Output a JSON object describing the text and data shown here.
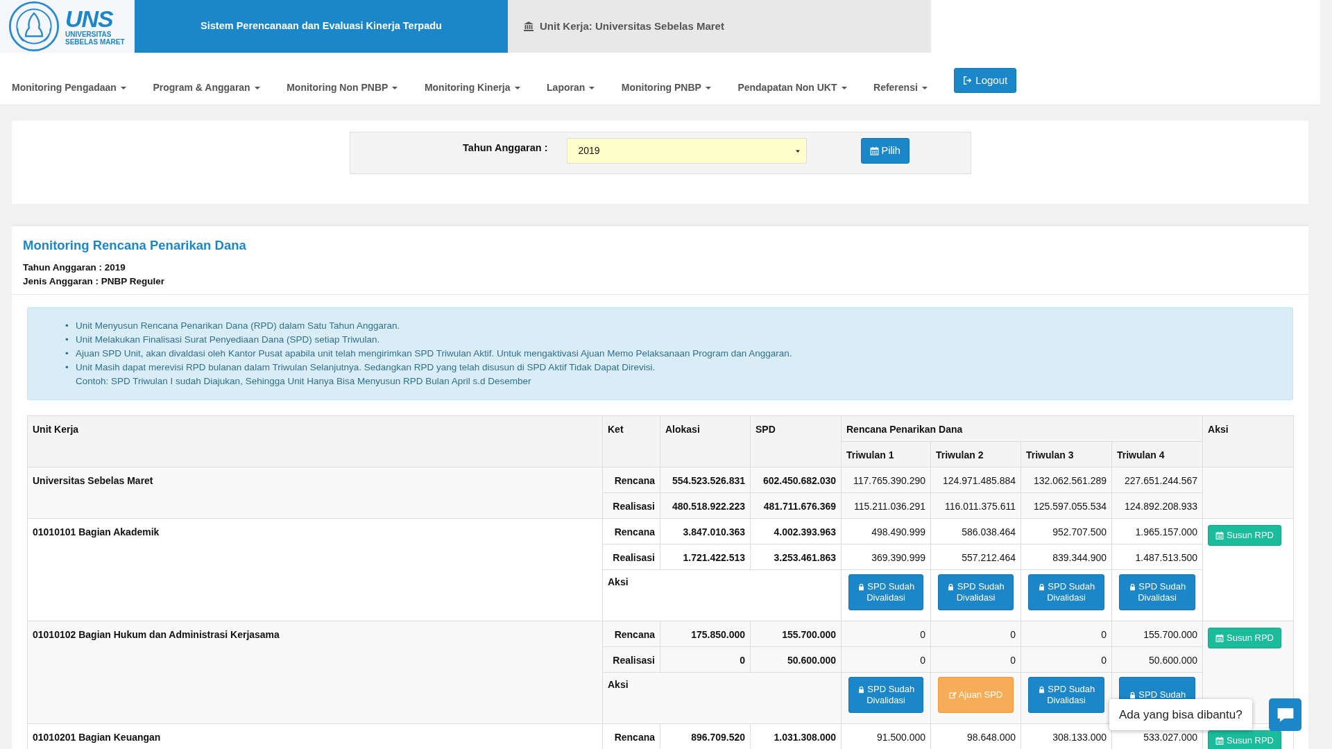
{
  "header": {
    "logo": {
      "abbr": "UNS",
      "line_1": "UNIVERSITAS",
      "line_2": "SEBELAS MARET"
    },
    "app_title": "Sistem Perencanaan dan Evaluasi Kinerja Terpadu",
    "unit_label": "Unit Kerja: Universitas Sebelas Maret"
  },
  "nav": {
    "items": [
      "Monitoring Pengadaan",
      "Program & Anggaran",
      "Monitoring Non PNBP",
      "Monitoring Kinerja",
      "Laporan",
      "Monitoring PNBP",
      "Pendapatan Non UKT",
      "Referensi"
    ],
    "logout": "Logout"
  },
  "filter": {
    "label": "Tahun Anggaran :",
    "value": "2019",
    "button": "Pilih"
  },
  "report": {
    "title": "Monitoring Rencana Penarikan Dana",
    "meta": [
      "Tahun Anggaran : 2019",
      "Jenis Anggaran : PNBP Reguler"
    ],
    "notes": [
      {
        "marker": "•",
        "text": "Unit Menyusun Rencana Penarikan Dana (RPD) dalam Satu Tahun Anggaran."
      },
      {
        "marker": "•",
        "text": "Unit Melakukan Finalisasi Surat Penyediaan Dana (SPD) setiap Triwulan."
      },
      {
        "marker": "•",
        "text": "Ajuan SPD Unit, akan divaldasi oleh Kantor Pusat apabila unit telah mengirimkan SPD Triwulan Aktif. Untuk mengaktivasi Ajuan Memo Pelaksanaan Program dan Anggaran."
      },
      {
        "marker": "•",
        "text": "Unit Masih dapat merevisi RPD bulanan dalam Triwulan Selanjutnya. Sedangkan RPD yang telah disusun di SPD Aktif Tidak Dapat Direvisi.",
        "extra": "Contoh: SPD Triwulan I sudah Diajukan, Sehingga Unit Hanya Bisa Menyusun RPD Bulan April s.d Desember"
      }
    ],
    "table": {
      "columns": {
        "unit": "Unit Kerja",
        "ket": "Ket",
        "alokasi": "Alokasi",
        "spd": "SPD",
        "rpd": "Rencana Penarikan Dana",
        "quarters": [
          "Triwulan 1",
          "Triwulan 2",
          "Triwulan 3",
          "Triwulan 4"
        ],
        "aksi": "Aksi"
      },
      "units": [
        {
          "name": "Universitas Sebelas Maret",
          "rows": [
            {
              "ket": "Rencana",
              "alokasi": "554.523.526.831",
              "spd": "602.450.682.030",
              "quarters": [
                "117.765.390.290",
                "124.971.485.884",
                "132.062.561.289",
                "227.651.244.567"
              ]
            },
            {
              "ket": "Realisasi",
              "alokasi": "480.518.922.223",
              "spd": "481.711.676.369",
              "quarters": [
                "115.211.036.291",
                "116.011.375.611",
                "125.597.055.534",
                "124.892.208.933"
              ]
            }
          ]
        },
        {
          "name": "01010101 Bagian Akademik",
          "button": "Susun RPD",
          "rows": [
            {
              "ket": "Rencana",
              "alokasi": "3.847.010.363",
              "spd": "4.002.393.963",
              "quarters": [
                "498.490.999",
                "586.038.464",
                "952.707.500",
                "1.965.157.000"
              ]
            },
            {
              "ket": "Realisasi",
              "alokasi": "1.721.422.513",
              "spd": "3.253.461.863",
              "quarters": [
                "369.390.999",
                "557.212.464",
                "839.344.900",
                "1.487.513.500"
              ]
            }
          ],
          "actions_label": "Aksi",
          "actions": [
            {
              "kind": "validated",
              "label": "SPD Sudah Divalidasi"
            },
            {
              "kind": "validated",
              "label": "SPD Sudah Divalidasi"
            },
            {
              "kind": "validated",
              "label": "SPD Sudah Divalidasi"
            },
            {
              "kind": "validated",
              "label": "SPD Sudah Divalidasi"
            }
          ]
        },
        {
          "name": "01010102 Bagian Hukum dan Administrasi Kerjasama",
          "button": "Susun RPD",
          "rows": [
            {
              "ket": "Rencana",
              "alokasi": "175.850.000",
              "spd": "155.700.000",
              "quarters": [
                "0",
                "0",
                "0",
                "155.700.000"
              ]
            },
            {
              "ket": "Realisasi",
              "alokasi": "0",
              "spd": "50.600.000",
              "quarters": [
                "0",
                "0",
                "0",
                "50.600.000"
              ]
            }
          ],
          "actions_label": "Aksi",
          "actions": [
            {
              "kind": "validated",
              "label": "SPD Sudah Divalidasi"
            },
            {
              "kind": "submit",
              "label": "Ajuan SPD"
            },
            {
              "kind": "validated",
              "label": "SPD Sudah Divalidasi"
            },
            {
              "kind": "validated",
              "label": "SPD Sudah"
            }
          ]
        },
        {
          "name": "01010201 Bagian Keuangan",
          "button": "Susun RPD",
          "rows": [
            {
              "ket": "Rencana",
              "alokasi": "896.709.520",
              "spd": "1.031.308.000",
              "quarters": [
                "91.500.000",
                "98.648.000",
                "308.133.000",
                "533.027.000"
              ]
            }
          ]
        }
      ]
    }
  },
  "chat": {
    "prompt": "Ada yang bisa dibantu?"
  }
}
